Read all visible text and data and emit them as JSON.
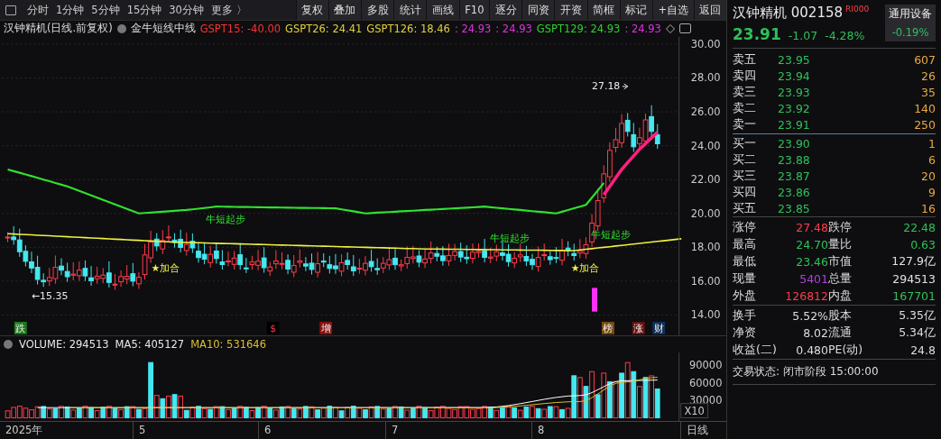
{
  "toolbar": {
    "periods": [
      "分时",
      "1分钟",
      "5分钟",
      "15分钟",
      "30分钟"
    ],
    "more": "更多 〉",
    "buttons": [
      "复权",
      "叠加",
      "多股",
      "统计",
      "画线",
      "F10",
      "逐分",
      "同资",
      "开资",
      "简框",
      "标记",
      "+自选",
      "返回"
    ]
  },
  "chart": {
    "title": "汉钟精机(日线.前复权)",
    "indicator": "金牛短线中线",
    "legend": [
      {
        "text": "GSPT15: -40.00",
        "color": "#ff3030"
      },
      {
        "text": "GSPT26: 24.41",
        "color": "#e0d040"
      },
      {
        "text": "GSPT126: 18.46",
        "color": "#e0d040"
      },
      {
        "text": ": 24.93",
        "color": "#e030e0"
      },
      {
        "text": ": 24.93",
        "color": "#e030e0"
      },
      {
        "text": "GSPT129: 24.93",
        "color": "#30d030"
      },
      {
        "text": ": 24.93",
        "color": "#e030e0"
      }
    ],
    "price_ticks": [
      "30.00",
      "28.00",
      "26.00",
      "24.00",
      "22.00",
      "20.00",
      "18.00",
      "16.00",
      "14.00"
    ],
    "high_label": "27.18",
    "low_label": "←15.35",
    "signals": [
      {
        "kind": "start",
        "text": "牛短起步"
      },
      {
        "kind": "start",
        "text": "牛短起步"
      },
      {
        "kind": "start",
        "text": "牛短起步"
      },
      {
        "kind": "add",
        "text": "★加合"
      },
      {
        "kind": "add",
        "text": "★加合"
      }
    ],
    "event_marks": [
      {
        "text": "跌",
        "color": "#1a7a1a"
      },
      {
        "text": "$",
        "color": "#000000"
      },
      {
        "text": "增",
        "color": "#8a1010"
      },
      {
        "text": "榜",
        "color": "#7a4a10"
      },
      {
        "text": "涨",
        "color": "#6a1010"
      },
      {
        "text": "财",
        "color": "#10305a"
      }
    ]
  },
  "volume": {
    "legend": [
      {
        "text": "VOLUME: 294513",
        "color": "#e8e8e8"
      },
      {
        "text": "MA5: 405127",
        "color": "#e8e8e8"
      },
      {
        "text": "MA10: 531646",
        "color": "#d8c030"
      }
    ],
    "ticks": [
      "90000",
      "60000",
      "30000"
    ],
    "scale": "X10",
    "dates": [
      "2025年",
      "5",
      "6",
      "7",
      "8"
    ],
    "period": "日线"
  },
  "quote": {
    "name": "汉钟精机",
    "code": "002158",
    "badge": "RI000",
    "sector": "通用设备",
    "sector_change": "-0.19%",
    "price": "23.91",
    "change": "-1.07",
    "percent": "-4.28%",
    "asks": [
      {
        "label": "卖五",
        "price": "23.95",
        "volume": "607"
      },
      {
        "label": "卖四",
        "price": "23.94",
        "volume": "26"
      },
      {
        "label": "卖三",
        "price": "23.93",
        "volume": "35"
      },
      {
        "label": "卖二",
        "price": "23.92",
        "volume": "140"
      },
      {
        "label": "卖一",
        "price": "23.91",
        "volume": "250"
      }
    ],
    "bids": [
      {
        "label": "买一",
        "price": "23.90",
        "volume": "1"
      },
      {
        "label": "买二",
        "price": "23.88",
        "volume": "6"
      },
      {
        "label": "买三",
        "price": "23.87",
        "volume": "20"
      },
      {
        "label": "买四",
        "price": "23.86",
        "volume": "9"
      },
      {
        "label": "买五",
        "price": "23.85",
        "volume": "16"
      }
    ],
    "stats": [
      [
        {
          "label": "涨停",
          "value": "27.48",
          "color": "#ff3c4c"
        },
        {
          "label": "跌停",
          "value": "22.48",
          "color": "#2ec05a"
        }
      ],
      [
        {
          "label": "最高",
          "value": "24.70",
          "color": "#2ec05a"
        },
        {
          "label": "量比",
          "value": "0.63",
          "color": "#2ec05a"
        }
      ],
      [
        {
          "label": "最低",
          "value": "23.46",
          "color": "#2ec05a"
        },
        {
          "label": "市值",
          "value": "127.9亿",
          "color": "#e0e0e0"
        }
      ],
      [
        {
          "label": "现量",
          "value": "5401",
          "color": "#b040e0"
        },
        {
          "label": "总量",
          "value": "294513",
          "color": "#e0e0e0"
        }
      ],
      [
        {
          "label": "外盘",
          "value": "126812",
          "color": "#ff3c4c"
        },
        {
          "label": "内盘",
          "value": "167701",
          "color": "#2ec05a"
        }
      ]
    ],
    "fundamentals": [
      [
        {
          "label": "换手",
          "value": "5.52%"
        },
        {
          "label": "股本",
          "value": "5.35亿"
        }
      ],
      [
        {
          "label": "净资",
          "value": "8.02"
        },
        {
          "label": "流通",
          "value": "5.34亿"
        }
      ],
      [
        {
          "label": "收益(二)",
          "value": "0.480"
        },
        {
          "label": "PE(动)",
          "value": "24.8"
        }
      ]
    ],
    "status": "交易状态: 闭市阶段 15:00:00"
  }
}
